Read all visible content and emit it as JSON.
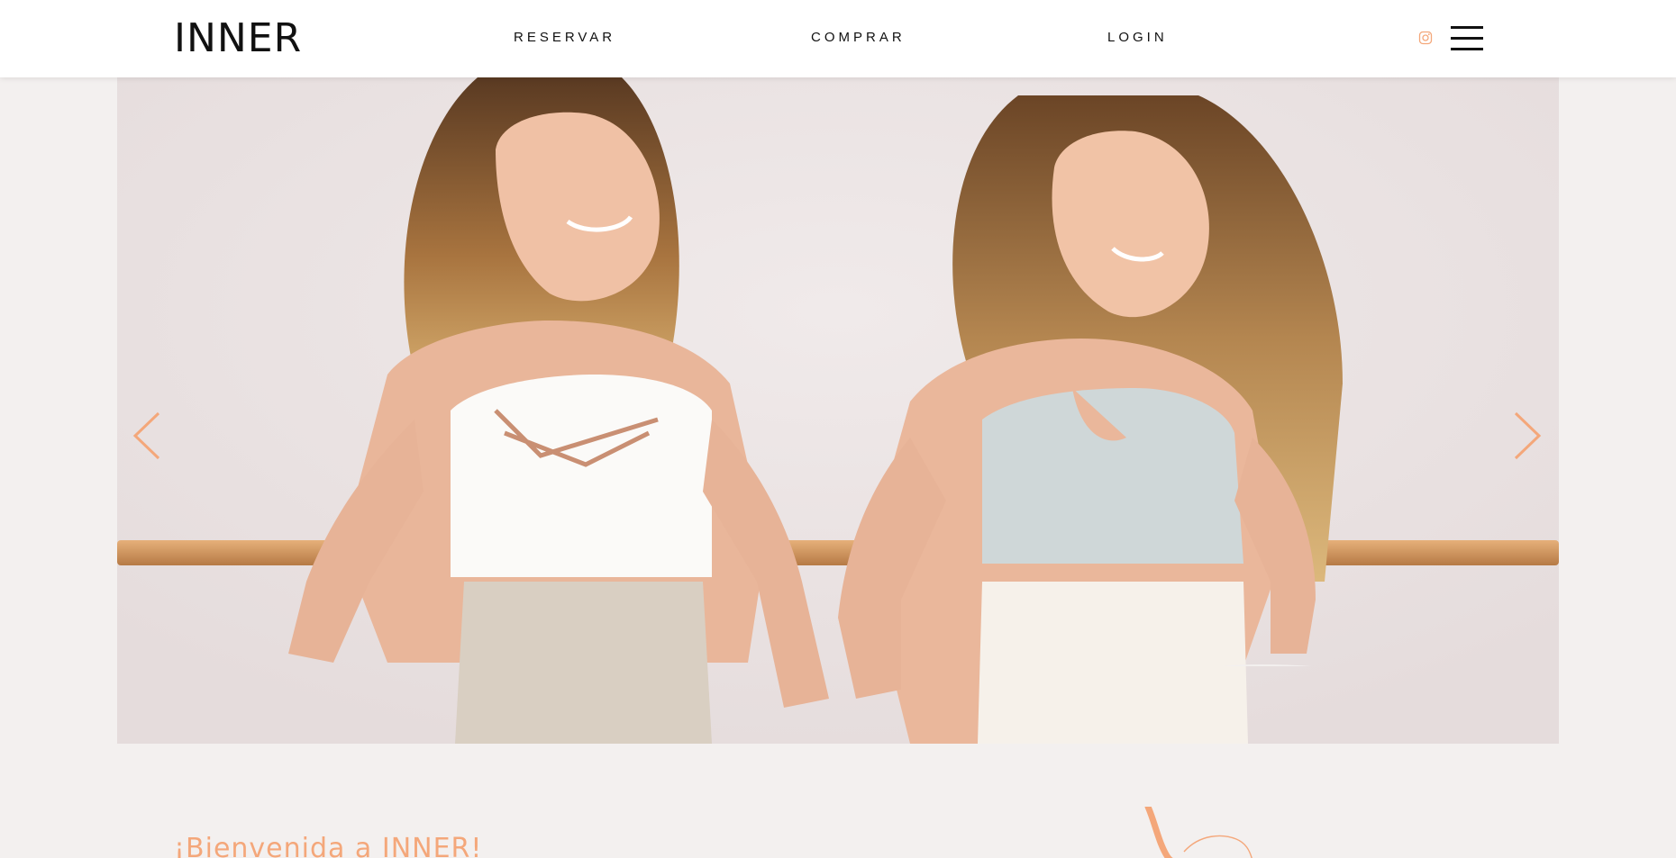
{
  "header": {
    "logo_text": "INNER",
    "nav": {
      "reservar": "RESERVAR",
      "comprar": "COMPRAR",
      "login": "LOGIN"
    },
    "icons": {
      "instagram": "instagram-icon",
      "menu": "hamburger-menu-icon"
    }
  },
  "hero": {
    "prev_arrow": "chevron-left-icon",
    "next_arrow": "chevron-right-icon",
    "image": "two women in sports bras leaning on a ballet barre"
  },
  "welcome": {
    "heading": "¡Bienvenida a INNER!"
  },
  "colors": {
    "accent": "#f4a77a",
    "background": "#f3f0ef",
    "header_bg": "#ffffff",
    "text": "#111111"
  }
}
